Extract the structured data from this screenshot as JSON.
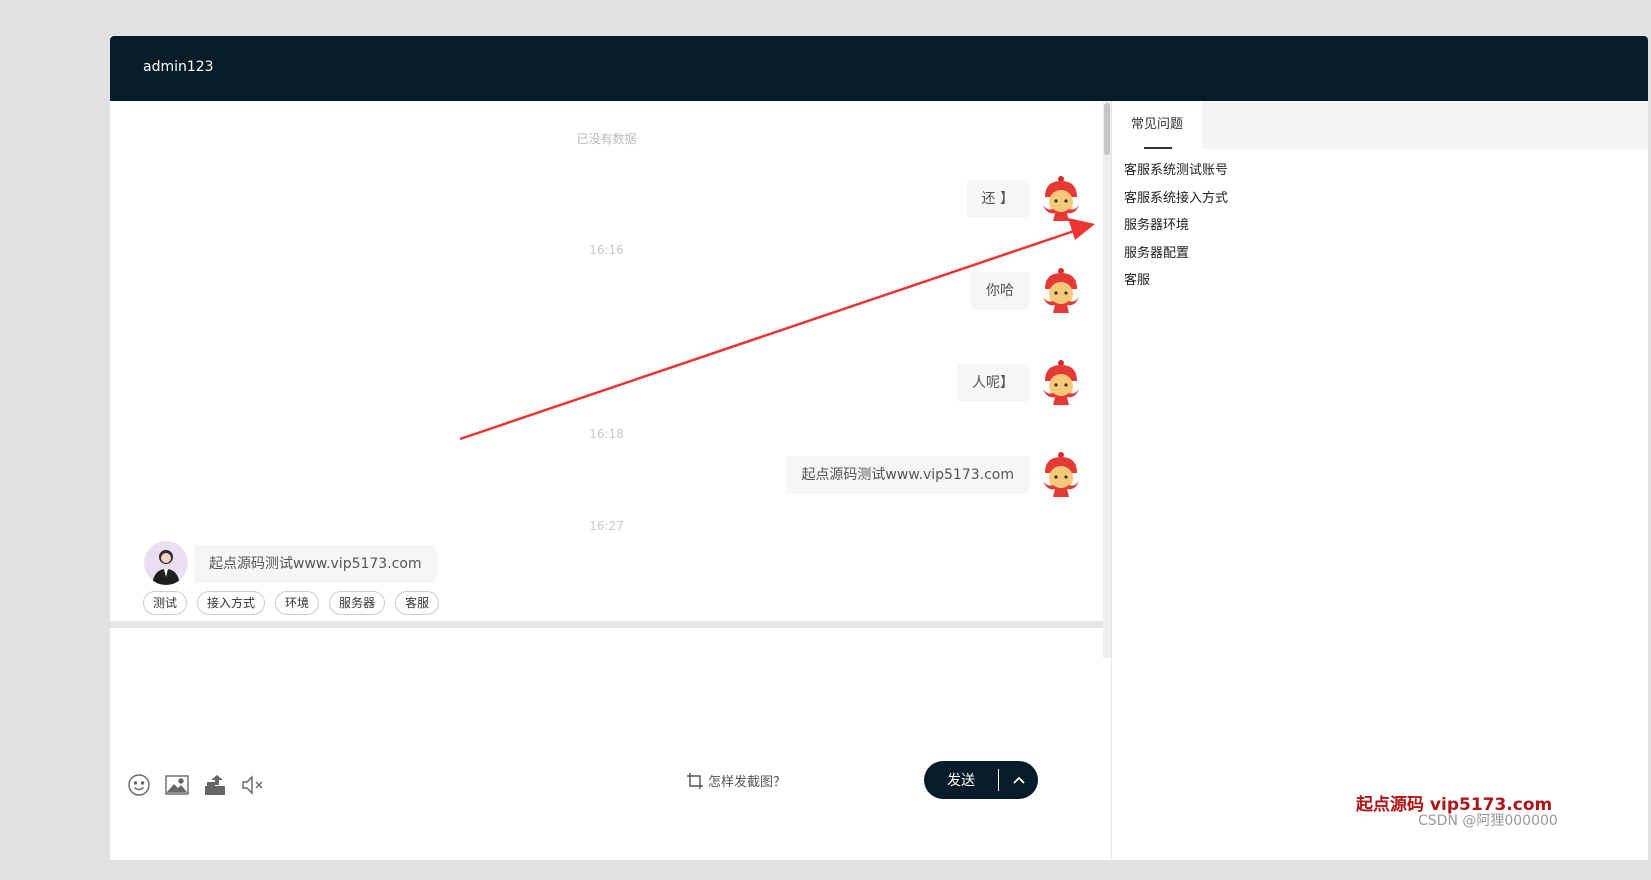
{
  "header": {
    "title": "admin123"
  },
  "chat": {
    "no_more": "已没有数据",
    "messages": [
      {
        "side": "right",
        "text": "还 】"
      },
      {
        "time": "16:16"
      },
      {
        "side": "right",
        "text": "你哈"
      },
      {
        "side": "right",
        "text": "人呢】"
      },
      {
        "time": "16:18"
      },
      {
        "side": "right",
        "text": "起点源码测试www.vip5173.com"
      },
      {
        "time": "16:27"
      },
      {
        "side": "left",
        "text": "起点源码测试www.vip5173.com"
      }
    ],
    "quick_replies": [
      "测试",
      "接入方式",
      "环境",
      "服务器",
      "客服"
    ]
  },
  "input": {
    "tools": [
      "smile-icon",
      "image-icon",
      "file-upload-icon",
      "mute-icon"
    ],
    "screenshot_help": "怎样发截图？",
    "send_label": "发送"
  },
  "side": {
    "tab": "常见问题",
    "faq": [
      "客服系统测试账号",
      "客服系统接入方式",
      "服务器环境",
      "服务器配置",
      "客服"
    ]
  },
  "watermark": {
    "brand": "起点源码  vip5173.com",
    "csdn": "CSDN @阿狸000000"
  },
  "colors": {
    "header": "#061d29",
    "arrow": "#ee3333",
    "watermark": "#b01515"
  }
}
